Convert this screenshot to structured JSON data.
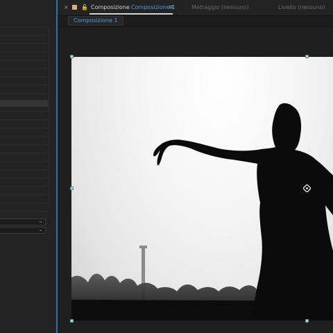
{
  "tabs": {
    "close_glyph": "×",
    "lock_glyph": "🔓",
    "composition_prefix": "Composizione",
    "composition_name": "Composizione 1",
    "menu_glyph": "≡",
    "footage": "Metraggio (nessuno)",
    "layer": "Livello (nessuno)"
  },
  "subbar": {
    "comp_chip": "Composizione 1"
  },
  "colors": {
    "accent": "#4b9cf0",
    "panel_border": "#2f6fb6",
    "handle": "#a9d7dc",
    "tab_swatch": "#d8b07a"
  },
  "icons": {
    "tab_close": "close-icon",
    "tab_swatch": "composition-color-swatch",
    "tab_lock": "lock-icon",
    "tab_menu": "hamburger-menu-icon",
    "anchor": "anchor-point-icon",
    "dropdown": "chevron-down-icon"
  }
}
